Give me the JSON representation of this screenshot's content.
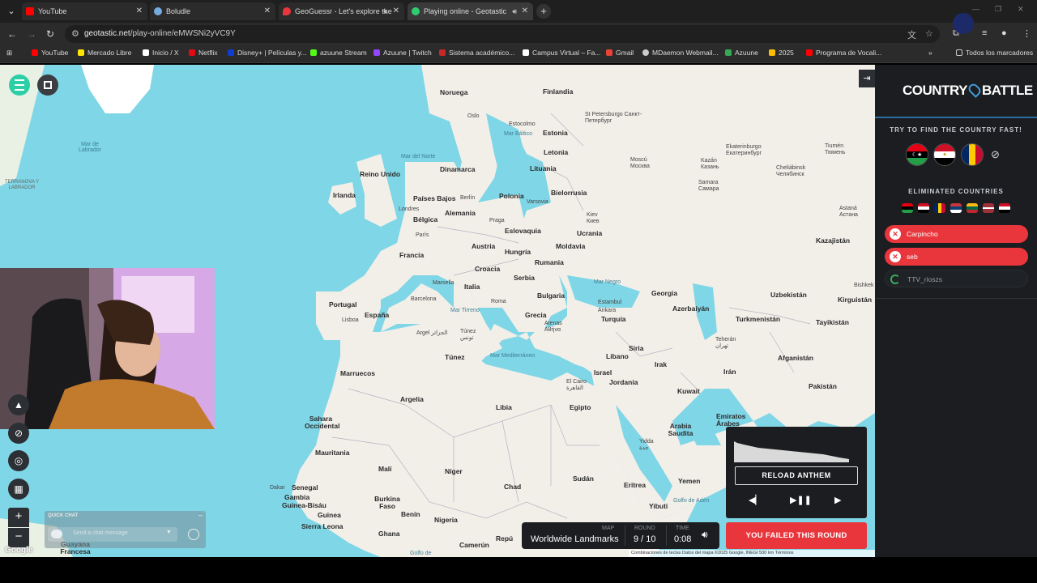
{
  "browser": {
    "tabs": [
      {
        "title": "YouTube",
        "favicon_color": "#ff0000",
        "active": false
      },
      {
        "title": "Boludle",
        "favicon_color": "#74acdf",
        "active": false
      },
      {
        "title": "GeoGuessr - Let's explore the",
        "favicon_color": "#e8363c",
        "active": false
      },
      {
        "title": "Playing online - Geotastic",
        "favicon_color": "#2ecc71",
        "active": true
      }
    ],
    "new_tab_label": "+",
    "url_host": "geotastic.net",
    "url_path": "/play-online/eMWSNi2yVC9Y",
    "bookmarks": [
      {
        "label": "YouTube",
        "color": "#ff0000"
      },
      {
        "label": "Mercado Libre",
        "color": "#ffe600"
      },
      {
        "label": "Inicio / X",
        "color": "#ffffff"
      },
      {
        "label": "Netflix",
        "color": "#e50914"
      },
      {
        "label": "Disney+ | Películas y...",
        "color": "#113ccf"
      },
      {
        "label": "azuune Stream",
        "color": "#53fc18"
      },
      {
        "label": "Azuune | Twitch",
        "color": "#9146ff"
      },
      {
        "label": "Sistema académico...",
        "color": "#c62828"
      },
      {
        "label": "Campus Virtual – Fa...",
        "color": "#ffffff"
      },
      {
        "label": "Gmail",
        "color": "#ea4335"
      },
      {
        "label": "MDaemon Webmail...",
        "color": "#cccccc"
      },
      {
        "label": "Azuune",
        "color": "#34a853"
      },
      {
        "label": "2025",
        "color": "#fbbc04"
      },
      {
        "label": "Programa de Vocali...",
        "color": "#ff0000"
      }
    ],
    "all_bookmarks_label": "Todos los marcadores"
  },
  "map": {
    "labels": {
      "noruega": "Noruega",
      "finlandia": "Finlandia",
      "suecia_city": "Estocolmo",
      "estonia": "Estonia",
      "letonia": "Letonia",
      "lituania": "Lituania",
      "spb": "St Petersburgo Санкт-Петербург",
      "moscu": "Moscú Москва",
      "oslo": "Oslo",
      "reino_unido": "Reino Unido",
      "irlanda": "Irlanda",
      "dinamarca": "Dinamarca",
      "paises_bajos": "Países Bajos",
      "berlin": "Berlín",
      "polonia": "Polonia",
      "bielorrusia": "Bielorrusia",
      "londres": "Londres",
      "belgica": "Bélgica",
      "alemania": "Alemania",
      "varsovia": "Varsovia",
      "kiev": "Kiev Киев",
      "ucrania": "Ucrania",
      "paris": "París",
      "praga": "Praga",
      "eslovaquia": "Eslovaquia",
      "francia": "Francia",
      "austria": "Austria",
      "hungria": "Hungría",
      "moldavia": "Moldavia",
      "croacia": "Croacia",
      "rumania": "Rumania",
      "serbia": "Serbia",
      "marsella": "Marsella",
      "italia": "Italia",
      "bulgaria": "Bulgaria",
      "portugal": "Portugal",
      "barcelona": "Barcelona",
      "espana": "España",
      "roma": "Roma",
      "estambul": "Estambul",
      "ankara": "Ankara",
      "turquia": "Turquía",
      "grecia": "Grecia",
      "atenas": "Atenas Αθήνα",
      "lisboa": "Lisboa",
      "argel": "Argel الجزائر",
      "tunez_city": "Túnez تونس",
      "tunez": "Túnez",
      "marruecos": "Marruecos",
      "argelia": "Argelia",
      "libia": "Libia",
      "egipto": "Egipto",
      "cairo": "El Cairo القاهرة",
      "siria": "Siria",
      "libano": "Líbano",
      "israel": "Israel",
      "jordania": "Jordania",
      "irak": "Irak",
      "iran": "Irán",
      "teheran": "Teherán تهران",
      "kuwait": "Kuwait",
      "arabia": "Arabia Saudita",
      "emiratos": "Emiratos Árabes",
      "yidda": "Yidda جدة",
      "georgia": "Georgia",
      "azerbaiyan": "Azerbaiyán",
      "turkmenistan": "Turkmenistán",
      "uzbekistan": "Uzbekistán",
      "kazajistan": "Kazajistán",
      "kirguistan": "Kirguistán",
      "tayikistan": "Tayikistán",
      "afganistan": "Afganistán",
      "pakistan": "Pakistán",
      "bishkek": "Bishkek",
      "astana": "Astaná Астана",
      "ekaterinburgo": "Ekaterinburgo Екатеринбург",
      "tiumen": "Tiumén Тюмень",
      "cheliabinsk": "Cheliábinsk Челябинск",
      "kazan": "Kazán Казань",
      "samara": "Samara Самара",
      "sahara": "Sahara Occidental",
      "mauritania": "Mauritania",
      "mali": "Malí",
      "niger": "Níger",
      "chad": "Chad",
      "sudan": "Sudán",
      "eritrea": "Eritrea",
      "yemen": "Yemen",
      "senegal": "Senegal",
      "dakar": "Dakar",
      "gambia": "Gambia",
      "guinea_bissau": "Guinea-Bisáu",
      "guinea": "Guinea",
      "sierra_leona": "Sierra Leona",
      "burkina": "Burkina Faso",
      "benin": "Benín",
      "ghana": "Ghana",
      "nigeria": "Nigeria",
      "camerun": "Camerún",
      "repu": "Repú",
      "yibuti": "Yibuti",
      "guyana": "Guayana Francesa",
      "terranova": "TERRANOVA Y LABRADOR",
      "mar_labrador": "Mar de Labrador",
      "mar_norte": "Mar del Norte",
      "mar_baltico": "Mar Báltico",
      "mar_negro": "Mar Negro",
      "mar_tirreno": "Mar Tirreno",
      "mar_mediterraneo": "Mar Mediterráneo",
      "golfo_aden": "Golfo de Adén",
      "golfo_guinea": "Golfo de"
    },
    "attribution": "Combinaciones de teclas   Datos del mapa ©2025 Google, INEGI   500 km   Términos",
    "google_logo": "Google"
  },
  "quick_chat": {
    "title": "QUICK CHAT",
    "minimize": "–",
    "placeholder": "Send a chat message"
  },
  "round_info": {
    "map_caption": "MAP",
    "map_value": "Worldwide Landmarks",
    "round_caption": "ROUND",
    "round_value": "9 / 10",
    "time_caption": "TIME",
    "time_value": "0:08"
  },
  "anthem": {
    "reload_label": "RELOAD ANTHEM"
  },
  "result": {
    "text": "YOU FAILED THIS ROUND"
  },
  "panel": {
    "logo_left": "COUNTRY",
    "logo_right": "BATTLE",
    "hint_title": "TRY TO FIND THE COUNTRY FAST!",
    "eliminated_title": "ELIMINATED COUNTRIES",
    "players": [
      {
        "name": "Carpincho",
        "status": "failed"
      },
      {
        "name": "seb",
        "status": "failed"
      },
      {
        "name": "TTV_rioszs",
        "status": "pending"
      }
    ]
  },
  "colors": {
    "accent_red": "#e8363c",
    "panel_bg": "#1b1d20",
    "water": "#7fd6e6",
    "land": "#f2efe9"
  }
}
